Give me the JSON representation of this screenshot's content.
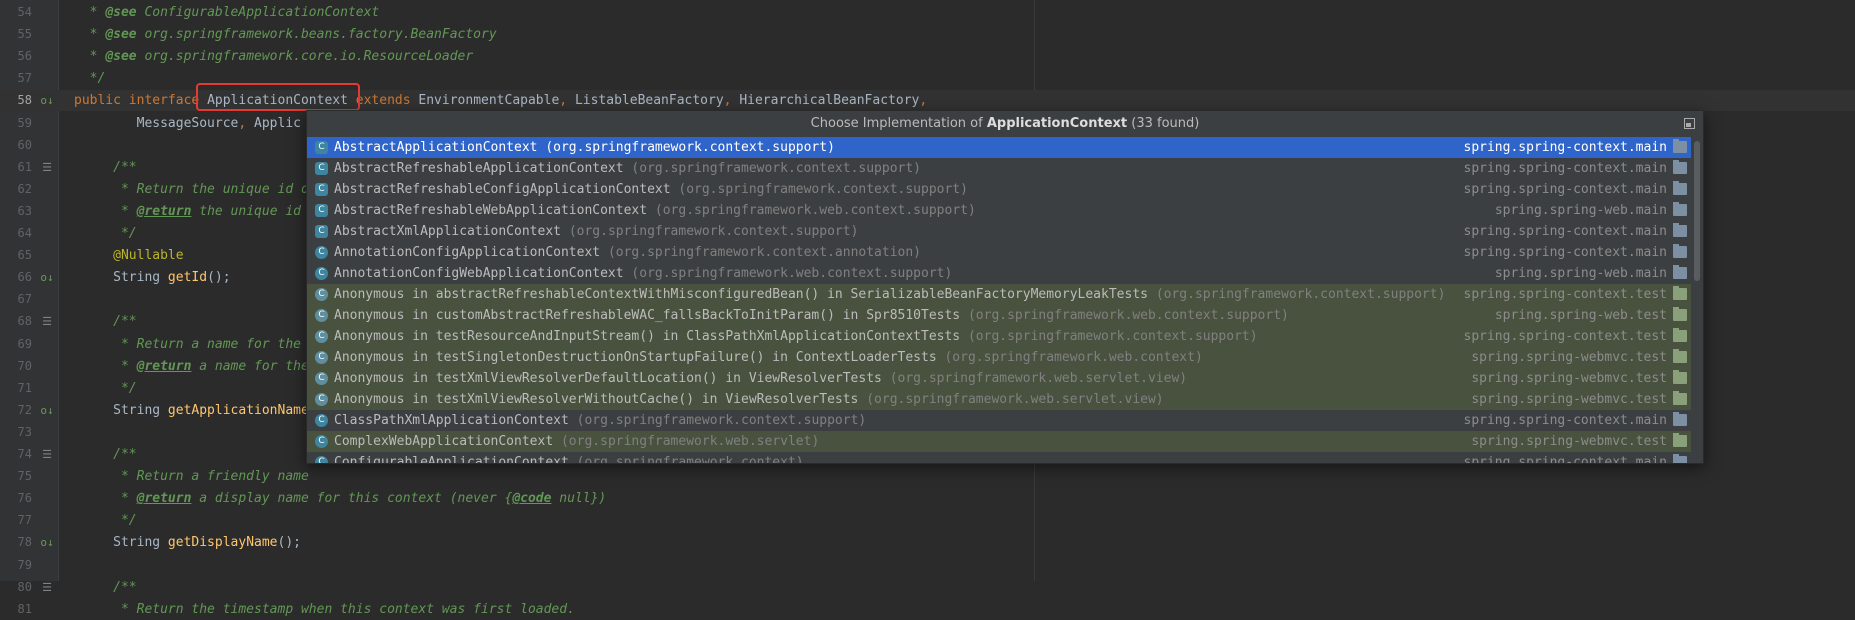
{
  "editor": {
    "lines": [
      {
        "n": "54",
        "parts": [
          {
            "c": "cm",
            "t": "  * "
          },
          {
            "c": "tagn",
            "t": "@see"
          },
          {
            "c": "cm",
            "t": " ConfigurableApplicationContext"
          }
        ]
      },
      {
        "n": "55",
        "parts": [
          {
            "c": "cm",
            "t": "  * "
          },
          {
            "c": "tagn",
            "t": "@see"
          },
          {
            "c": "cm",
            "t": " org.springframework.beans.factory.BeanFactory"
          }
        ]
      },
      {
        "n": "56",
        "parts": [
          {
            "c": "cm",
            "t": "  * "
          },
          {
            "c": "tagn",
            "t": "@see"
          },
          {
            "c": "cm",
            "t": " org.springframework.core.io.ResourceLoader"
          }
        ]
      },
      {
        "n": "57",
        "parts": [
          {
            "c": "cm",
            "t": "  */"
          }
        ]
      },
      {
        "n": "58",
        "cur": true,
        "icon": "o↓",
        "parts": [
          {
            "c": "kw",
            "t": "public interface "
          },
          {
            "c": "ty",
            "t": "ApplicationContext "
          },
          {
            "c": "kw",
            "t": "extends "
          },
          {
            "c": "ty",
            "t": "EnvironmentCapable"
          },
          {
            "c": "kw",
            "t": ", "
          },
          {
            "c": "ty",
            "t": "ListableBeanFactory"
          },
          {
            "c": "kw",
            "t": ", "
          },
          {
            "c": "ty",
            "t": "HierarchicalBeanFactory"
          },
          {
            "c": "kw",
            "t": ","
          }
        ]
      },
      {
        "n": "59",
        "parts": [
          {
            "c": "ty",
            "t": "        MessageSource"
          },
          {
            "c": "kw",
            "t": ", "
          },
          {
            "c": "ty",
            "t": "Applic"
          }
        ]
      },
      {
        "n": "60",
        "parts": []
      },
      {
        "n": "61",
        "doc": true,
        "parts": [
          {
            "c": "cm",
            "t": "     /**"
          }
        ]
      },
      {
        "n": "62",
        "parts": [
          {
            "c": "cm",
            "t": "      * Return the unique id o"
          }
        ]
      },
      {
        "n": "63",
        "parts": [
          {
            "c": "cm",
            "t": "      * "
          },
          {
            "c": "tag",
            "t": "@return"
          },
          {
            "c": "cm",
            "t": " the unique id "
          }
        ]
      },
      {
        "n": "64",
        "parts": [
          {
            "c": "cm",
            "t": "      */"
          }
        ]
      },
      {
        "n": "65",
        "parts": [
          {
            "c": "ann",
            "t": "     @Nullable"
          }
        ]
      },
      {
        "n": "66",
        "icon": "o↓",
        "parts": [
          {
            "c": "ty",
            "t": "     String "
          },
          {
            "c": "fn",
            "t": "getId"
          },
          {
            "c": "ty",
            "t": "();"
          }
        ]
      },
      {
        "n": "67",
        "parts": []
      },
      {
        "n": "68",
        "doc": true,
        "parts": [
          {
            "c": "cm",
            "t": "     /**"
          }
        ]
      },
      {
        "n": "69",
        "parts": [
          {
            "c": "cm",
            "t": "      * Return a name for the "
          }
        ]
      },
      {
        "n": "70",
        "parts": [
          {
            "c": "cm",
            "t": "      * "
          },
          {
            "c": "tag",
            "t": "@return"
          },
          {
            "c": "cm",
            "t": " a name for the"
          }
        ]
      },
      {
        "n": "71",
        "parts": [
          {
            "c": "cm",
            "t": "      */"
          }
        ]
      },
      {
        "n": "72",
        "icon": "o↓",
        "parts": [
          {
            "c": "ty",
            "t": "     String "
          },
          {
            "c": "fn",
            "t": "getApplicationName"
          }
        ]
      },
      {
        "n": "73",
        "parts": []
      },
      {
        "n": "74",
        "doc": true,
        "parts": [
          {
            "c": "cm",
            "t": "     /**"
          }
        ]
      },
      {
        "n": "75",
        "parts": [
          {
            "c": "cm",
            "t": "      * Return a friendly name"
          }
        ]
      },
      {
        "n": "76",
        "parts": [
          {
            "c": "cm",
            "t": "      * "
          },
          {
            "c": "tag",
            "t": "@return"
          },
          {
            "c": "cm",
            "t": " a display name for this context (never {"
          },
          {
            "c": "tag",
            "t": "@code"
          },
          {
            "c": "cm",
            "t": " null})"
          }
        ]
      },
      {
        "n": "77",
        "parts": [
          {
            "c": "cm",
            "t": "      */"
          }
        ]
      },
      {
        "n": "78",
        "icon": "o↓",
        "parts": [
          {
            "c": "ty",
            "t": "     String "
          },
          {
            "c": "fn",
            "t": "getDisplayName"
          },
          {
            "c": "ty",
            "t": "();"
          }
        ]
      },
      {
        "n": "79",
        "parts": []
      },
      {
        "n": "80",
        "doc": true,
        "parts": [
          {
            "c": "cm",
            "t": "     /**"
          }
        ]
      },
      {
        "n": "81",
        "parts": [
          {
            "c": "cm",
            "t": "      * Return the timestamp when this context was first loaded."
          }
        ]
      }
    ]
  },
  "popup": {
    "title_prefix": "Choose Implementation of ",
    "title_bold": "ApplicationContext",
    "title_suffix": " (33 found)",
    "items": [
      {
        "name": "AbstractApplicationContext",
        "pkg": "(org.springframework.context.support)",
        "module": "spring.spring-context.main",
        "kind": "abs",
        "selected": true
      },
      {
        "name": "AbstractRefreshableApplicationContext",
        "pkg": "(org.springframework.context.support)",
        "module": "spring.spring-context.main",
        "kind": "abs"
      },
      {
        "name": "AbstractRefreshableConfigApplicationContext",
        "pkg": "(org.springframework.context.support)",
        "module": "spring.spring-context.main",
        "kind": "abs"
      },
      {
        "name": "AbstractRefreshableWebApplicationContext",
        "pkg": "(org.springframework.web.context.support)",
        "module": "spring.spring-web.main",
        "kind": "abs"
      },
      {
        "name": "AbstractXmlApplicationContext",
        "pkg": "(org.springframework.context.support)",
        "module": "spring.spring-context.main",
        "kind": "abs"
      },
      {
        "name": "AnnotationConfigApplicationContext",
        "pkg": "(org.springframework.context.annotation)",
        "module": "spring.spring-context.main",
        "kind": "cls"
      },
      {
        "name": "AnnotationConfigWebApplicationContext",
        "pkg": "(org.springframework.web.context.support)",
        "module": "spring.spring-web.main",
        "kind": "cls"
      },
      {
        "name": "Anonymous in abstractRefreshableContextWithMisconfiguredBean() in SerializableBeanFactoryMemoryLeakTests",
        "pkg": "(org.springframework.context.support)",
        "module": "spring.spring-context.test",
        "kind": "anon",
        "test": true
      },
      {
        "name": "Anonymous in customAbstractRefreshableWAC_fallsBackToInitParam() in Spr8510Tests",
        "pkg": "(org.springframework.web.context.support)",
        "module": "spring.spring-web.test",
        "kind": "anon",
        "test": true
      },
      {
        "name": "Anonymous in testResourceAndInputStream() in ClassPathXmlApplicationContextTests",
        "pkg": "(org.springframework.context.support)",
        "module": "spring.spring-context.test",
        "kind": "anon",
        "test": true
      },
      {
        "name": "Anonymous in testSingletonDestructionOnStartupFailure() in ContextLoaderTests",
        "pkg": "(org.springframework.web.context)",
        "module": "spring.spring-webmvc.test",
        "kind": "anon",
        "test": true
      },
      {
        "name": "Anonymous in testXmlViewResolverDefaultLocation() in ViewResolverTests",
        "pkg": "(org.springframework.web.servlet.view)",
        "module": "spring.spring-webmvc.test",
        "kind": "anon",
        "test": true
      },
      {
        "name": "Anonymous in testXmlViewResolverWithoutCache() in ViewResolverTests",
        "pkg": "(org.springframework.web.servlet.view)",
        "module": "spring.spring-webmvc.test",
        "kind": "anon",
        "test": true
      },
      {
        "name": "ClassPathXmlApplicationContext",
        "pkg": "(org.springframework.context.support)",
        "module": "spring.spring-context.main",
        "kind": "cls"
      },
      {
        "name": "ComplexWebApplicationContext",
        "pkg": "(org.springframework.web.servlet)",
        "module": "spring.spring-webmvc.test",
        "kind": "cls",
        "test": true
      },
      {
        "name": "ConfigurableApplicationContext",
        "pkg": "(org.springframework.context)",
        "module": "spring.spring-context.main",
        "kind": "cls"
      }
    ]
  }
}
